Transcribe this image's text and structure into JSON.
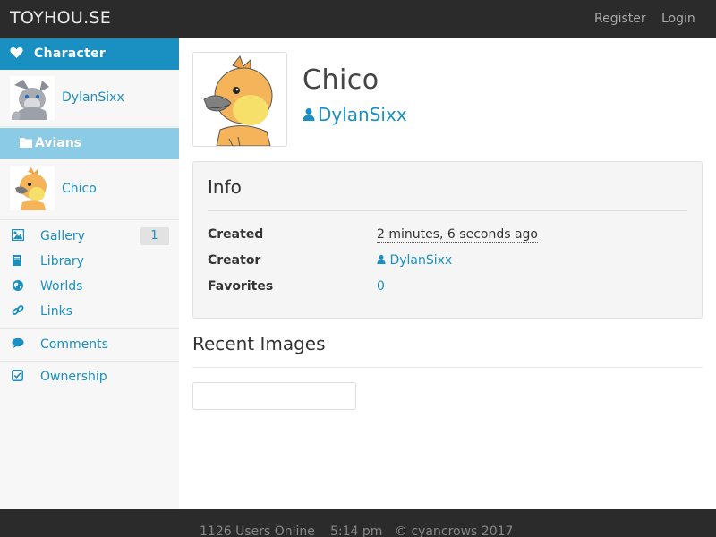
{
  "topnav": {
    "brand": "TOYHOU.SE",
    "register": "Register",
    "login": "Login"
  },
  "sidebar": {
    "header": {
      "icon": "heart-icon",
      "label": "Character"
    },
    "owner_thumb": {
      "label": "DylanSixx"
    },
    "group": {
      "icon": "folder-icon",
      "label": "Avians"
    },
    "char_thumb": {
      "label": "Chico"
    },
    "menu": [
      {
        "key": "gallery",
        "icon": "image-icon",
        "label": "Gallery",
        "badge": "1"
      },
      {
        "key": "library",
        "icon": "book-icon",
        "label": "Library"
      },
      {
        "key": "worlds",
        "icon": "globe-icon",
        "label": "Worlds"
      },
      {
        "key": "links",
        "icon": "link-icon",
        "label": "Links"
      },
      {
        "key": "comments",
        "icon": "comment-icon",
        "label": "Comments"
      },
      {
        "key": "ownership",
        "icon": "check-square-icon",
        "label": "Ownership"
      }
    ]
  },
  "profile": {
    "name": "Chico",
    "owner": "DylanSixx"
  },
  "info": {
    "title": "Info",
    "rows": [
      {
        "key": "Created",
        "value": "2 minutes, 6 seconds ago"
      },
      {
        "key": "Creator",
        "value": "DylanSixx"
      },
      {
        "key": "Favorites",
        "value": "0"
      }
    ]
  },
  "recent": {
    "title": "Recent Images"
  },
  "footer": {
    "online": "1126 Users Online",
    "time": "5:14 pm",
    "copyright": "© cyancrows 2017"
  },
  "colors": {
    "accent": "#1a8fc1",
    "nav_bg": "#2b2b2b",
    "group_bg": "#8ccbe5"
  }
}
